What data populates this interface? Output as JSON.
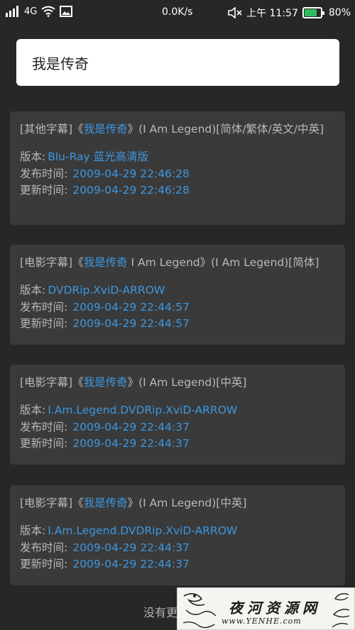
{
  "status_bar": {
    "network": "4G",
    "speed": "0.0K/s",
    "time": "上午 11:57",
    "battery_text": "80%",
    "battery_level": 0.8,
    "battery_color": "#2dbb5f",
    "icons": [
      "signal-icon",
      "wifi-icon",
      "image-notification-icon",
      "mute-icon",
      "battery-icon"
    ]
  },
  "search": {
    "value": "我是传奇"
  },
  "labels": {
    "version": "版本:",
    "published": "发布时间:",
    "updated": "更新时间:"
  },
  "results": [
    {
      "prefix": "[其他字幕]《",
      "highlight": "我是传奇",
      "suffix": "》(I Am Legend)[简体/繁体/英文/中英]",
      "version": "Blu-Ray 蓝光高清版",
      "published": "2009-04-29 22:46:28",
      "updated": "2009-04-29 22:46:28"
    },
    {
      "prefix": "[电影字幕]《",
      "highlight": "我是传奇",
      "suffix": " I Am Legend》(I Am Legend)[简体]",
      "version": "DVDRip.XviD-ARROW",
      "published": "2009-04-29 22:44:57",
      "updated": "2009-04-29 22:44:57"
    },
    {
      "prefix": "[电影字幕]《",
      "highlight": "我是传奇",
      "suffix": "》(I Am Legend)[中英]",
      "version": "I.Am.Legend.DVDRip.XviD-ARROW",
      "published": "2009-04-29 22:44:37",
      "updated": "2009-04-29 22:44:37"
    },
    {
      "prefix": "[电影字幕]《",
      "highlight": "我是传奇",
      "suffix": "》(I Am Legend)[中英]",
      "version": "I.Am.Legend.DVDRip.XviD-ARROW",
      "published": "2009-04-29 22:44:37",
      "updated": "2009-04-29 22:44:37"
    }
  ],
  "footer": {
    "text": "没有更多数据"
  },
  "watermark": {
    "title": "夜河资源网",
    "url": "www.YENHE.com"
  },
  "colors": {
    "background": "#272727",
    "card": "#3a3a3a",
    "accent": "#3d97e0",
    "text": "#b9b9b9"
  }
}
